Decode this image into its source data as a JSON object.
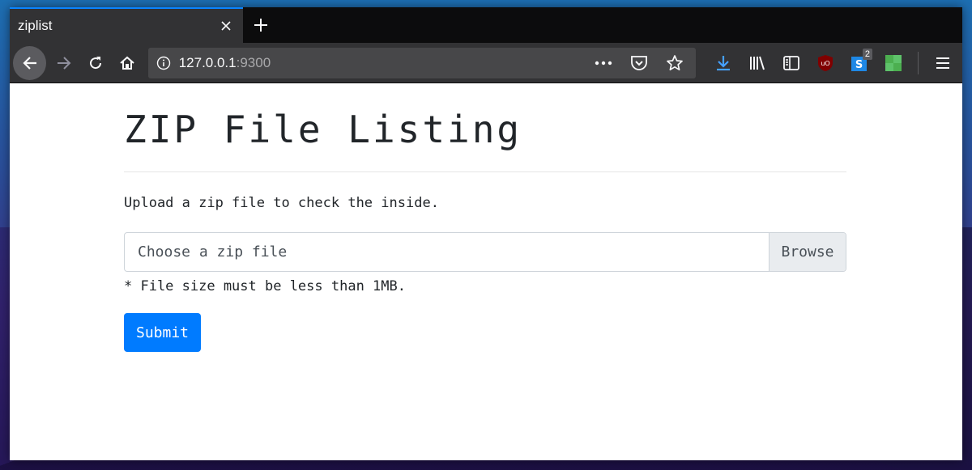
{
  "browser": {
    "tab_title": "ziplist",
    "url_host": "127.0.0.1",
    "url_port": ":9300",
    "extension_badge": "2",
    "accent_color": "#0a84ff"
  },
  "page": {
    "title": "ZIP File Listing",
    "intro": "Upload a zip file to check the inside.",
    "file_placeholder": "Choose a zip file",
    "browse_label": "Browse",
    "size_note": "* File size must be less than 1MB.",
    "submit_label": "Submit",
    "submit_color": "#007bff"
  },
  "icons": [
    "close-icon",
    "plus-icon",
    "back-arrow-icon",
    "forward-arrow-icon",
    "reload-icon",
    "home-icon",
    "info-icon",
    "more-icon",
    "pocket-icon",
    "star-icon",
    "download-icon",
    "library-icon",
    "sidebar-icon",
    "ublock-icon",
    "extension-s-icon",
    "extension-green-icon",
    "menu-icon"
  ]
}
